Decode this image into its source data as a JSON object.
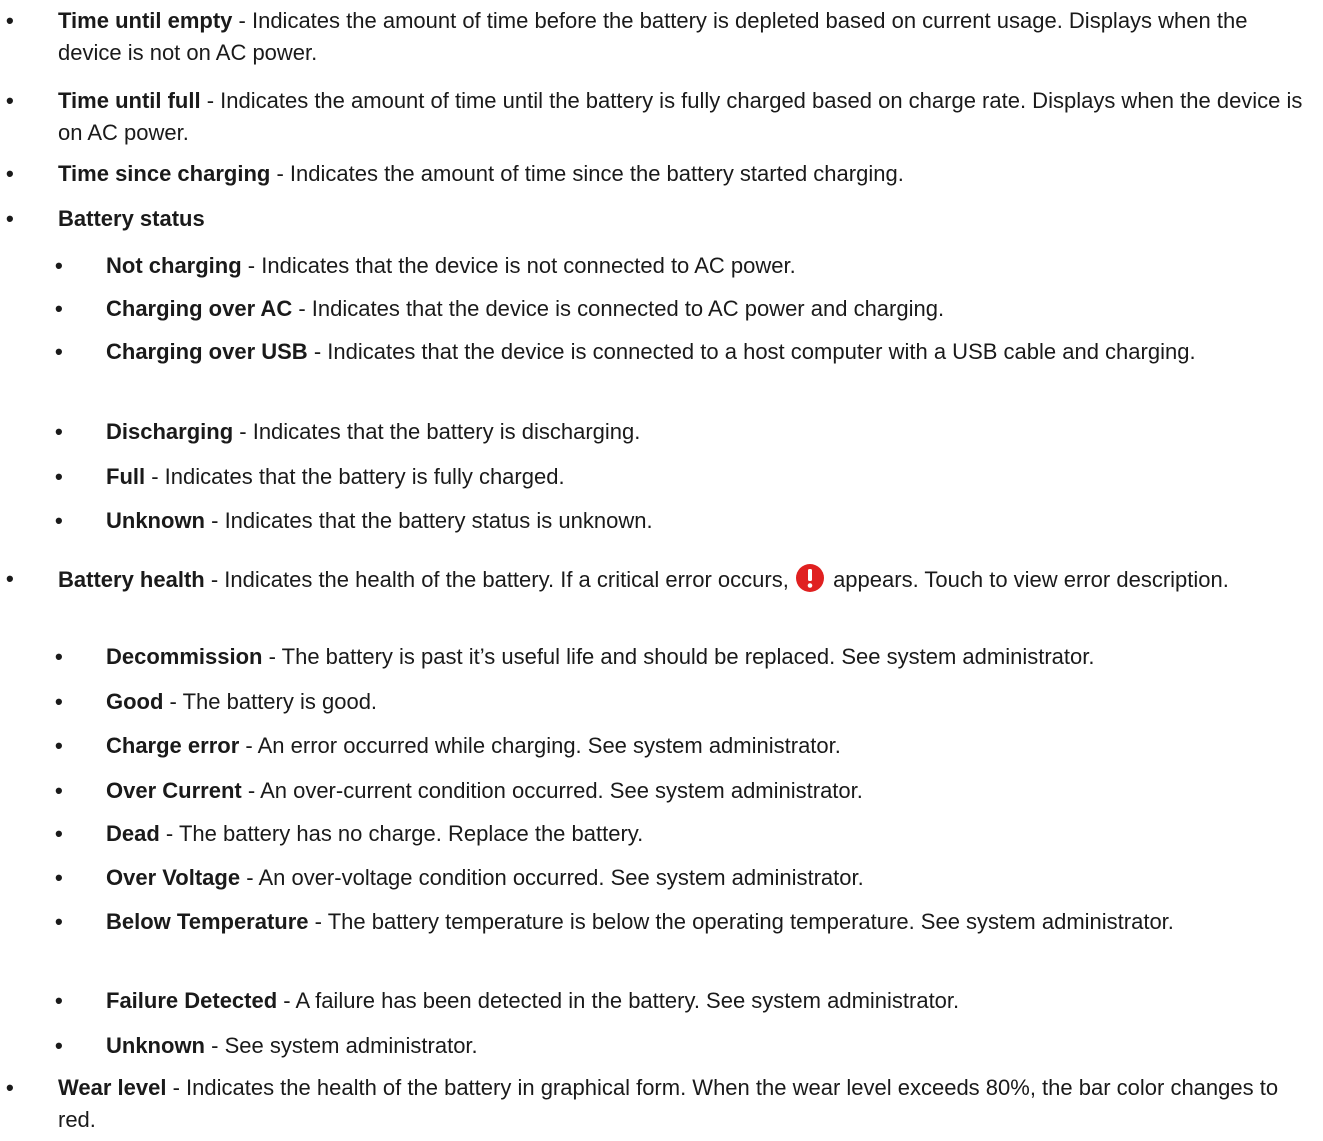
{
  "bullet_char": "•",
  "separator": " - ",
  "colors": {
    "text": "#1a1a1a",
    "alert_icon": "#e02020"
  },
  "items": [
    {
      "term": "Time until empty",
      "description": "Indicates the amount of time before the battery is depleted based on current usage. Displays when the device is not on AC power."
    },
    {
      "term": "Time until full",
      "description": "Indicates the amount of time until the battery is fully charged based on charge rate. Displays when the device is on AC power."
    },
    {
      "term": "Time since charging",
      "description": "Indicates the amount of time since the battery started charging."
    },
    {
      "term": "Battery status",
      "sub": [
        {
          "term": "Not charging",
          "description": "Indicates that the device is not connected to AC power."
        },
        {
          "term": "Charging over AC",
          "description": "Indicates that the device is connected to AC power and charging."
        },
        {
          "term": "Charging over USB",
          "description": "Indicates that the device is connected to a host computer with a USB cable and charging."
        },
        {
          "term": "Discharging",
          "description": "Indicates that the battery is discharging."
        },
        {
          "term": "Full",
          "description": "Indicates that the battery is fully charged."
        },
        {
          "term": "Unknown",
          "description": "Indicates that the battery status is unknown."
        }
      ]
    },
    {
      "term": "Battery health",
      "description_before_icon": "Indicates the health of the battery. If a critical error occurs,",
      "icon": "critical-error-icon",
      "description_after_icon": "appears. Touch to view error description.",
      "sub": [
        {
          "term": "Decommission",
          "description": "The battery is past it’s useful life and should be replaced. See system administrator."
        },
        {
          "term": "Good",
          "description": "The battery is good."
        },
        {
          "term": "Charge error",
          "description": "An error occurred while charging. See system administrator."
        },
        {
          "term": "Over Current",
          "description": "An over-current condition occurred. See system administrator."
        },
        {
          "term": "Dead",
          "description": "The battery has no charge. Replace the battery."
        },
        {
          "term": "Over Voltage",
          "description": "An over-voltage condition occurred. See system administrator."
        },
        {
          "term": "Below Temperature",
          "description": "The battery temperature is below the operating temperature. See system administrator."
        },
        {
          "term": "Failure Detected",
          "description": "A failure has been detected in the battery. See system administrator."
        },
        {
          "term": "Unknown",
          "description": "See system administrator."
        }
      ]
    },
    {
      "term": "Wear level",
      "description": "Indicates the health of the battery in graphical form. When the wear level exceeds 80%, the bar color changes to red."
    }
  ]
}
